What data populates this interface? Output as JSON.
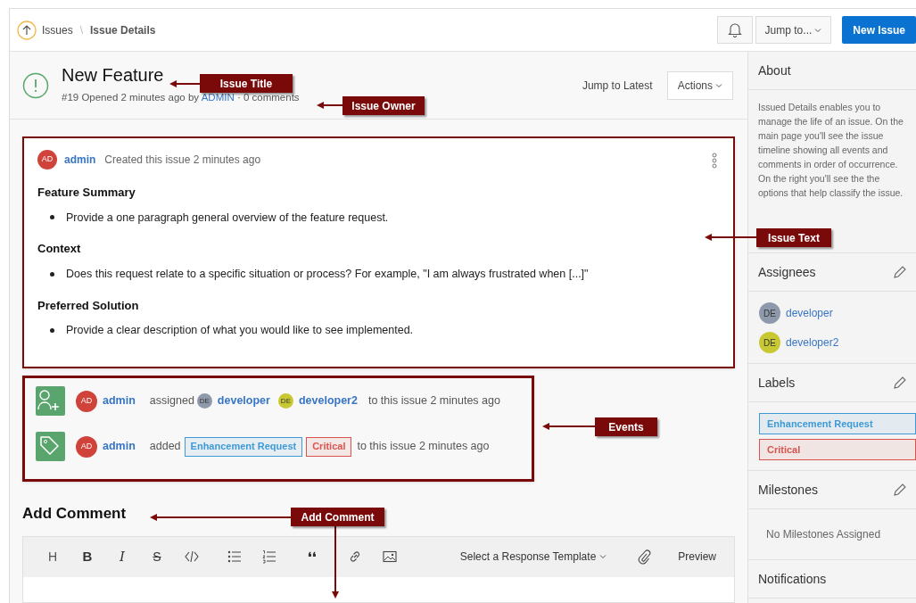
{
  "breadcrumb": [
    {
      "label": "Issues"
    },
    {
      "label": "Issue Details"
    }
  ],
  "breadcrumb_separator": "\\",
  "header": {
    "jump": "Jump to...",
    "new_issue": "New Issue"
  },
  "issue": {
    "title": "New Feature",
    "meta_prefix": "#19 Opened 2 minutes ago by",
    "owner": "ADMIN",
    "meta_suffix": "· 0 comments",
    "jump_latest": "Jump to Latest",
    "actions": "Actions"
  },
  "comment": {
    "avatar": "AD",
    "author": "admin",
    "action": "Created this issue 2 minutes ago",
    "sections": [
      {
        "heading": "Feature Summary",
        "items": [
          "Provide a one paragraph general overview of the feature request."
        ]
      },
      {
        "heading": "Context",
        "items": [
          "Does this request relate to a specific situation or process? For example, \"I am always frustrated when [...]\""
        ]
      },
      {
        "heading": "Preferred Solution",
        "items": [
          "Provide a clear description of what you would like to see implemented."
        ]
      }
    ]
  },
  "events": [
    {
      "kind": "assign",
      "avatar": "AD",
      "author": "admin",
      "verb": "assigned",
      "people": [
        {
          "initials": "DE",
          "name": "developer",
          "color": "#8e9aab"
        },
        {
          "initials": "DE",
          "name": "developer2",
          "color": "#c8c832"
        }
      ],
      "suffix": "to this issue 2 minutes ago"
    },
    {
      "kind": "label",
      "avatar": "AD",
      "author": "admin",
      "verb": "added",
      "labels": [
        {
          "name": "Enhancement Request",
          "color": "#3d9ad6"
        },
        {
          "name": "Critical",
          "color": "#d9534f"
        }
      ],
      "suffix": "to this issue 2 minutes ago"
    }
  ],
  "add_comment": {
    "title": "Add Comment",
    "tools": [
      {
        "kind": "heading",
        "glyph": "H"
      },
      {
        "kind": "bold",
        "glyph": "B"
      },
      {
        "kind": "italic",
        "glyph": "I"
      },
      {
        "kind": "strike",
        "glyph": "S"
      },
      {
        "kind": "code"
      },
      {
        "kind": "bullets"
      },
      {
        "kind": "numbers"
      },
      {
        "kind": "quote",
        "glyph": "❛❛"
      },
      {
        "kind": "link"
      },
      {
        "kind": "image"
      }
    ],
    "template": "Select a Response Template",
    "preview": "Preview"
  },
  "sidebar": {
    "about_title": "About",
    "about_text": "Issued Details enables you to manage the life of an issue. On the main page you'll see the issue timeline showing all events and comments in order of occurrence. On the right you'll see the the options that help classify the issue.",
    "assignees_title": "Assignees",
    "assignees": [
      {
        "initials": "DE",
        "name": "developer",
        "color": "#8e9aab"
      },
      {
        "initials": "DE",
        "name": "developer2",
        "color": "#c8c832"
      }
    ],
    "labels_title": "Labels",
    "labels": [
      {
        "name": "Enhancement Request",
        "color": "#3d9ad6"
      },
      {
        "name": "Critical",
        "color": "#d9534f"
      }
    ],
    "milestones_title": "Milestones",
    "milestones_empty": "No Milestones Assigned",
    "notifications_title": "Notifications"
  },
  "callouts": [
    {
      "label": "Issue Title"
    },
    {
      "label": "Issue Owner"
    },
    {
      "label": "Issue Text"
    },
    {
      "label": "Events"
    },
    {
      "label": "Add Comment"
    }
  ]
}
